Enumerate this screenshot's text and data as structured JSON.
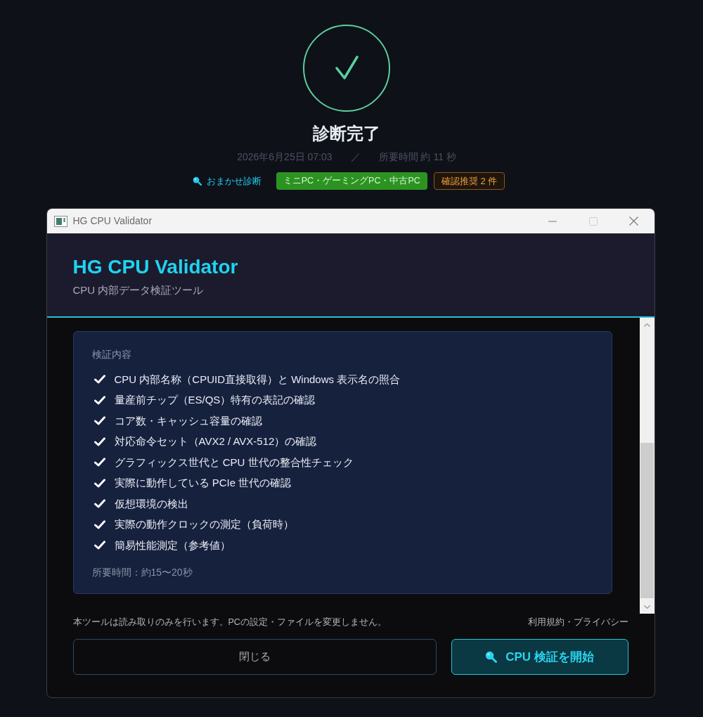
{
  "status": {
    "title": "診断完了",
    "date": "2026年6月25日 07:03",
    "separator": "／",
    "duration": "所要時間 約 11 秒"
  },
  "tags": [
    {
      "kind": "link",
      "label": "おまかせ診断"
    },
    {
      "kind": "category",
      "label": "ミニPC・ゲーミングPC・中古PC"
    },
    {
      "kind": "warning",
      "label": "確認推奨 2 件"
    }
  ],
  "window": {
    "title": "HG CPU Validator"
  },
  "app_header": {
    "title": "HG CPU Validator",
    "subtitle": "CPU 内部データ検証ツール"
  },
  "checks_card": {
    "heading": "検証内容",
    "items": [
      "CPU 内部名称（CPUID直接取得）と Windows 表示名の照合",
      "量産前チップ（ES/QS）特有の表記の確認",
      "コア数・キャッシュ容量の確認",
      "対応命令セット（AVX2 / AVX-512）の確認",
      "グラフィックス世代と CPU 世代の整合性チェック",
      "実際に動作している PCIe 世代の確認",
      "仮想環境の検出",
      "実際の動作クロックの測定（負荷時）",
      "簡易性能測定（参考値）"
    ],
    "note": "所要時間：約15〜20秒"
  },
  "footer": {
    "notice": "本ツールは読み取りのみを行います。PCの設定・ファイルを変更しません。",
    "link": "利用規約・プライバシー"
  },
  "buttons": [
    {
      "kind": "secondary",
      "label": "閉じる"
    },
    {
      "kind": "primary",
      "label": "CPU 検証を開始"
    }
  ]
}
